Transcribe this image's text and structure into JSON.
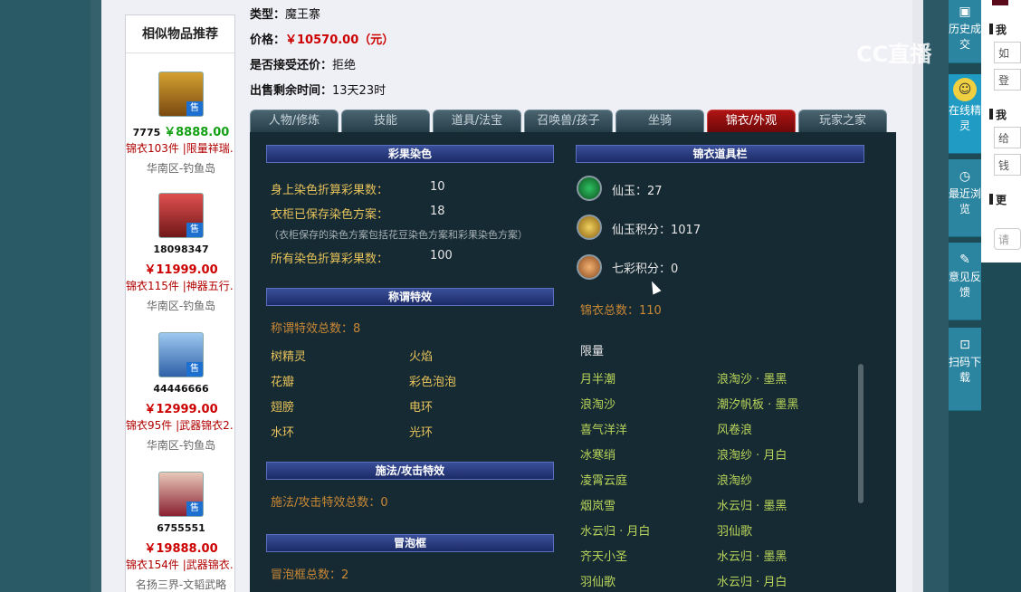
{
  "colors": {
    "accent_red": "#c00000",
    "price_green": "#14a014",
    "panel_bg": "#162a33",
    "section_head": "#2b3c80",
    "tab_active": "#b01414"
  },
  "similar": {
    "title": "相似物品推荐",
    "sell_tag": "售",
    "items": [
      {
        "name": "7775",
        "price": "￥8888.00",
        "desc": "锦衣103件 |限量祥瑞…",
        "server": "华南区-钓鱼岛",
        "avatar": "lion-avatar"
      },
      {
        "name": "18098347",
        "price": "￥11999.00",
        "desc": "锦衣115件 |神器五行…",
        "server": "华南区-钓鱼岛",
        "avatar": "red-hair-avatar"
      },
      {
        "name": "44446666",
        "price": "￥12999.00",
        "desc": "锦衣95件 |武器锦衣2…",
        "server": "华南区-钓鱼岛",
        "avatar": "blue-avatar"
      },
      {
        "name": "6755551",
        "price": "￥19888.00",
        "desc": "锦衣154件 |武器锦衣…",
        "server": "名扬三界-文韬武略",
        "avatar": "girl-avatar"
      }
    ]
  },
  "info": {
    "type_label": "类型：",
    "type_value": "魔王寨",
    "price_label": "价格：",
    "price_value": "￥10570.00（元）",
    "bargain_label": "是否接受还价：",
    "bargain_value": "拒绝",
    "time_label": "出售剩余时间：",
    "time_value": "13天23时"
  },
  "tabs": [
    "人物/修炼",
    "技能",
    "道具/法宝",
    "召唤兽/孩子",
    "坐骑",
    "锦衣/外观",
    "玩家之家"
  ],
  "active_tab": "锦衣/外观",
  "dye": {
    "title": "彩果染色",
    "body_label": "身上染色折算彩果数：",
    "body_value": "10",
    "wardrobe_label": "衣柜已保存染色方案：",
    "wardrobe_value": "18",
    "note": "（衣柜保存的染色方案包括花豆染色方案和彩果染色方案）",
    "all_label": "所有染色折算彩果数：",
    "all_value": "100"
  },
  "title_effects": {
    "title": "称谓特效",
    "total": "称谓特效总数：8",
    "items": [
      "树精灵",
      "火焰",
      "花瓣",
      "彩色泡泡",
      "翅膀",
      "电环",
      "水环",
      "光环"
    ]
  },
  "spell_effects": {
    "title": "施法/攻击特效",
    "total": "施法/攻击特效总数：0"
  },
  "bubble": {
    "title": "冒泡框",
    "total": "冒泡框总数：2"
  },
  "costume_bar": {
    "title": "锦衣道具栏",
    "xianyu": "仙玉：27",
    "xianyu_points": "仙玉积分：1017",
    "qicai_points": "七彩积分：0",
    "total": "锦衣总数：110",
    "limited_label": "限量",
    "limited_items": [
      [
        "月半潮",
        "浪淘沙 · 墨黑"
      ],
      [
        "浪淘沙",
        "潮汐帆板 · 墨黑"
      ],
      [
        "喜气洋洋",
        "风卷浪"
      ],
      [
        "冰寒绡",
        "浪淘纱 · 月白"
      ],
      [
        "凌霄云庭",
        "浪淘纱"
      ],
      [
        "烟岚雪",
        "水云归 · 墨黑"
      ],
      [
        "水云归 · 月白",
        "羽仙歌"
      ],
      [
        "齐天小圣",
        "水云归 · 墨黑"
      ],
      [
        "羽仙歌",
        "水云归 · 月白"
      ]
    ]
  },
  "sidebar": {
    "history": "历史成交",
    "online": "在线精灵",
    "recent": "最近浏览",
    "feedback": "意见反馈",
    "scan": "扫码下载"
  },
  "far_right": {
    "l1": "我",
    "l2": "如",
    "l3": "登",
    "l4": "我",
    "l5": "给",
    "l6": "钱",
    "l7": "更",
    "l8": "请"
  },
  "watermark": "CC直播"
}
